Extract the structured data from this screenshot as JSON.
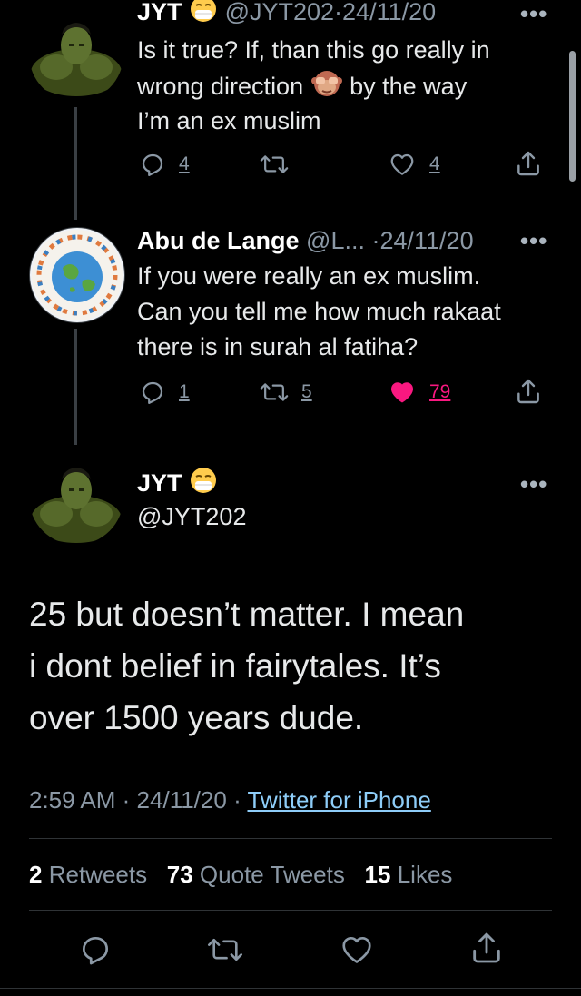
{
  "tweet1": {
    "name": "JYT",
    "handle": "@JYT202",
    "sep": "·",
    "date": "24/11/20",
    "line1": "Is it true? If, than this go really in",
    "line2a": "wrong direction",
    "line2b": "by the way",
    "line3": "I’m an ex muslim",
    "reply_count": "4",
    "like_count": "4"
  },
  "tweet2": {
    "name": "Abu de Lange",
    "handle": "@L...",
    "sep": "·",
    "date": "24/11/20",
    "line1": "If you were really an ex muslim.",
    "line2": "Can you tell me how much rakaat",
    "line3": "there is in surah al fatiha?",
    "reply_count": "1",
    "retweet_count": "5",
    "like_count": "79"
  },
  "main": {
    "name": "JYT",
    "handle": "@JYT202",
    "line1": "25 but doesn’t matter. I mean",
    "line2": "i dont belief in fairytales. It’s",
    "line3": "over 1500 years dude.",
    "time": "2:59 AM",
    "sep1": "·",
    "date": "24/11/20",
    "sep2": "·",
    "source": "Twitter for iPhone",
    "retweets_num": "2",
    "retweets_label": "Retweets",
    "quotes_num": "73",
    "quotes_label": "Quote Tweets",
    "likes_num": "15",
    "likes_label": "Likes"
  },
  "colors": {
    "background": "#000000",
    "text": "#e7e9ea",
    "muted": "#8b98a5",
    "like_active": "#f91880",
    "link": "#8ecdf8"
  },
  "icons": [
    "reply-icon",
    "retweet-icon",
    "like-icon",
    "share-icon",
    "more-icon",
    "mask-face-emoji",
    "see-no-evil-monkey-emoji"
  ]
}
